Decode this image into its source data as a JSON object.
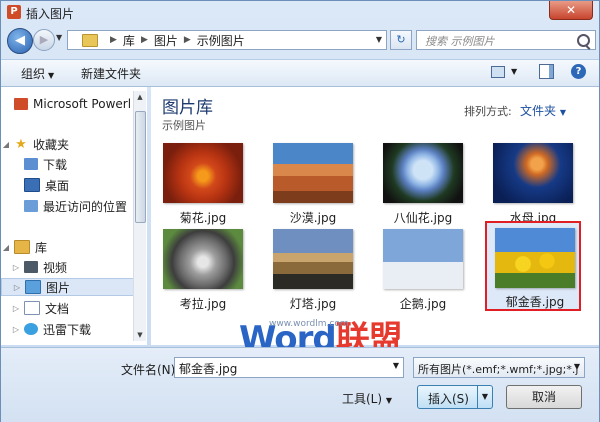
{
  "window": {
    "title": "插入图片",
    "app_icon": "P"
  },
  "address": {
    "crumbs": [
      "库",
      "图片",
      "示例图片"
    ],
    "search_placeholder": "搜索 示例图片"
  },
  "toolbar": {
    "organize": "组织",
    "new_folder": "新建文件夹",
    "help": "?"
  },
  "nav": {
    "items": [
      {
        "label": "Microsoft Powerl",
        "icon": "powerpoint-icon"
      },
      {
        "label": "收藏夹",
        "icon": "star-icon"
      },
      {
        "label": "下载",
        "icon": "downloads-icon"
      },
      {
        "label": "桌面",
        "icon": "desktop-icon"
      },
      {
        "label": "最近访问的位置",
        "icon": "recent-places-icon"
      },
      {
        "label": "库",
        "icon": "library-icon"
      },
      {
        "label": "视频",
        "icon": "video-icon"
      },
      {
        "label": "图片",
        "icon": "pictures-icon"
      },
      {
        "label": "文档",
        "icon": "documents-icon"
      },
      {
        "label": "迅雷下载",
        "icon": "xunlei-icon"
      }
    ]
  },
  "content": {
    "library_title": "图片库",
    "library_sub": "示例图片",
    "arrange_label": "排列方式:",
    "arrange_value": "文件夹",
    "files": [
      {
        "name": "菊花.jpg"
      },
      {
        "name": "沙漠.jpg"
      },
      {
        "name": "八仙花.jpg"
      },
      {
        "name": "水母.jpg"
      },
      {
        "name": "考拉.jpg"
      },
      {
        "name": "灯塔.jpg"
      },
      {
        "name": "企鹅.jpg"
      },
      {
        "name": "郁金香.jpg",
        "selected": true
      }
    ]
  },
  "watermark": {
    "word": "Word",
    "cn": "联盟",
    "url": "www.wordlm.com"
  },
  "bottom": {
    "filename_label": "文件名(N):",
    "filename_value": "郁金香.jpg",
    "filter_value": "所有图片(*.emf;*.wmf;*.jpg;*.j",
    "tools": "工具(L)",
    "insert": "插入(S)",
    "cancel": "取消"
  },
  "colors": {
    "selection_border": "#e01e24",
    "accent": "#1e50a2"
  }
}
